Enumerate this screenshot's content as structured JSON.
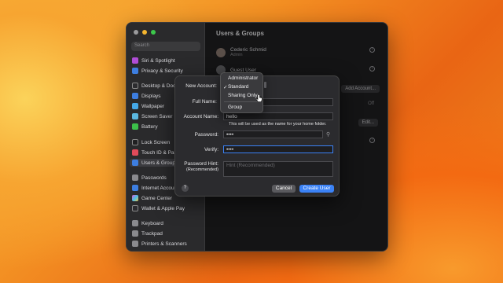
{
  "window": {
    "title": "Users & Groups",
    "search_placeholder": "Search"
  },
  "sidebar": {
    "items": [
      {
        "label": "Siri & Spotlight",
        "icon": "siri-icon"
      },
      {
        "label": "Privacy & Security",
        "icon": "hand-icon"
      },
      {
        "label": "Desktop & Dock",
        "icon": "dock-icon"
      },
      {
        "label": "Displays",
        "icon": "display-icon"
      },
      {
        "label": "Wallpaper",
        "icon": "wallpaper-icon"
      },
      {
        "label": "Screen Saver",
        "icon": "screensaver-icon"
      },
      {
        "label": "Battery",
        "icon": "battery-icon"
      },
      {
        "label": "Lock Screen",
        "icon": "lock-icon"
      },
      {
        "label": "Touch ID & Password",
        "icon": "fingerprint-icon"
      },
      {
        "label": "Users & Groups",
        "icon": "users-icon"
      },
      {
        "label": "Passwords",
        "icon": "key-icon"
      },
      {
        "label": "Internet Accounts",
        "icon": "at-icon"
      },
      {
        "label": "Game Center",
        "icon": "gamecenter-icon"
      },
      {
        "label": "Wallet & Apple Pay",
        "icon": "wallet-icon"
      },
      {
        "label": "Keyboard",
        "icon": "keyboard-icon"
      },
      {
        "label": "Trackpad",
        "icon": "trackpad-icon"
      },
      {
        "label": "Printers & Scanners",
        "icon": "printer-icon"
      }
    ]
  },
  "users": [
    {
      "name": "Cederic Schmid",
      "role": "Admin"
    },
    {
      "name": "Guest User",
      "role": ""
    }
  ],
  "main_buttons": {
    "add_account": "Add Account...",
    "off": "Off",
    "edit": "Edit..."
  },
  "dialog": {
    "new_account_label": "New Account:",
    "full_name_label": "Full Name:",
    "account_name_label": "Account Name:",
    "account_name_value": "hello",
    "account_name_hint": "This will be used as the name for your home folder.",
    "password_label": "Password:",
    "password_value": "••••",
    "verify_label": "Verify:",
    "verify_value": "••••",
    "hint_label": "Password Hint:",
    "hint_sub": "(Recommended)",
    "hint_placeholder": "Hint (Recommended)",
    "cancel": "Cancel",
    "create": "Create User",
    "help": "?"
  },
  "dropdown": {
    "options": [
      "Administrator",
      "Standard",
      "Sharing Only",
      "Group"
    ],
    "checkmark": "✓",
    "selected": "Standard",
    "highlighted": "Sharing Only"
  },
  "colors": {
    "accent": "#3b82f6"
  }
}
